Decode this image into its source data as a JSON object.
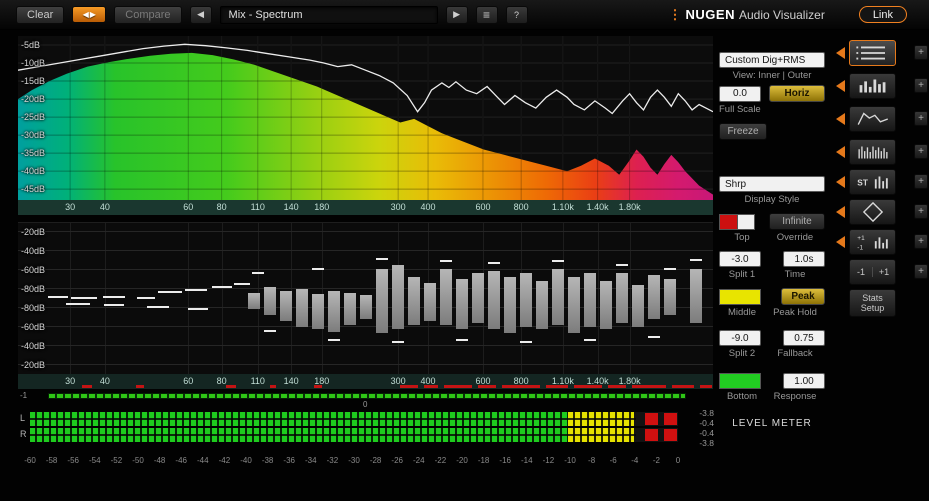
{
  "toolbar": {
    "clear": "Clear",
    "compare": "Compare",
    "preset": "Mix - Spectrum",
    "help": "?",
    "link": "Link",
    "brand_name": "NUGEN",
    "brand_product": "Audio Visualizer"
  },
  "freq_axis": [
    {
      "label": "30",
      "f": 0.075
    },
    {
      "label": "40",
      "f": 0.125
    },
    {
      "label": "60",
      "f": 0.245
    },
    {
      "label": "80",
      "f": 0.293
    },
    {
      "label": "110",
      "f": 0.345
    },
    {
      "label": "140",
      "f": 0.393
    },
    {
      "label": "180",
      "f": 0.437
    },
    {
      "label": "300",
      "f": 0.547
    },
    {
      "label": "400",
      "f": 0.59
    },
    {
      "label": "600",
      "f": 0.669
    },
    {
      "label": "800",
      "f": 0.724
    },
    {
      "label": "1.10k",
      "f": 0.784
    },
    {
      "label": "1.40k",
      "f": 0.834
    },
    {
      "label": "1.80k",
      "f": 0.88
    }
  ],
  "spectrum": {
    "type": "area+line",
    "y_labels": [
      "-5dB",
      "-10dB",
      "-15dB",
      "-20dB",
      "-25dB",
      "-30dB",
      "-35dB",
      "-40dB",
      "-45dB"
    ],
    "y_gridlines_db": [
      -5,
      -10,
      -15,
      -20,
      -25,
      -30,
      -35,
      -40,
      -45
    ],
    "ylim": [
      -48,
      -2.5
    ],
    "gradient": [
      [
        0,
        "#009f9f"
      ],
      [
        0.07,
        "#00b07a"
      ],
      [
        0.14,
        "#28c32a"
      ],
      [
        0.3,
        "#44cb1c"
      ],
      [
        0.44,
        "#9ed011"
      ],
      [
        0.52,
        "#ccd40c"
      ],
      [
        0.6,
        "#e9bc07"
      ],
      [
        0.68,
        "#ec9405"
      ],
      [
        0.76,
        "#ee6a05"
      ],
      [
        0.83,
        "#ea3f14"
      ],
      [
        0.89,
        "#dd2050"
      ],
      [
        0.95,
        "#d41a6e"
      ],
      [
        1,
        "#c81878"
      ]
    ],
    "area_points": [
      [
        0,
        -20
      ],
      [
        0.02,
        -17.5
      ],
      [
        0.045,
        -15
      ],
      [
        0.07,
        -13
      ],
      [
        0.1,
        -11
      ],
      [
        0.13,
        -9.8
      ],
      [
        0.16,
        -8.8
      ],
      [
        0.19,
        -8
      ],
      [
        0.22,
        -7.4
      ],
      [
        0.25,
        -7.2
      ],
      [
        0.28,
        -7.8
      ],
      [
        0.31,
        -9
      ],
      [
        0.34,
        -10.5
      ],
      [
        0.37,
        -12.5
      ],
      [
        0.4,
        -14.5
      ],
      [
        0.43,
        -16.5
      ],
      [
        0.46,
        -19
      ],
      [
        0.49,
        -21.5
      ],
      [
        0.52,
        -24
      ],
      [
        0.55,
        -26.5
      ],
      [
        0.57,
        -25.5
      ],
      [
        0.59,
        -27.5
      ],
      [
        0.61,
        -29.5
      ],
      [
        0.63,
        -31
      ],
      [
        0.65,
        -32.5
      ],
      [
        0.67,
        -34
      ],
      [
        0.7,
        -35.5
      ],
      [
        0.73,
        -37
      ],
      [
        0.76,
        -38.5
      ],
      [
        0.79,
        -40
      ],
      [
        0.81,
        -38.5
      ],
      [
        0.83,
        -36.5
      ],
      [
        0.85,
        -38.5
      ],
      [
        0.865,
        -41
      ],
      [
        0.88,
        -37
      ],
      [
        0.89,
        -34
      ],
      [
        0.9,
        -36
      ],
      [
        0.91,
        -39
      ],
      [
        0.92,
        -41
      ],
      [
        0.93,
        -38
      ],
      [
        0.94,
        -35.5
      ],
      [
        0.95,
        -37.5
      ],
      [
        0.96,
        -40
      ],
      [
        0.97,
        -42
      ],
      [
        0.98,
        -44
      ],
      [
        1,
        -46.5
      ]
    ],
    "line_points": [
      [
        0,
        -12
      ],
      [
        0.03,
        -11
      ],
      [
        0.06,
        -10
      ],
      [
        0.09,
        -9
      ],
      [
        0.12,
        -8
      ],
      [
        0.15,
        -7
      ],
      [
        0.18,
        -6
      ],
      [
        0.21,
        -5.3
      ],
      [
        0.24,
        -4.8
      ],
      [
        0.27,
        -5.2
      ],
      [
        0.3,
        -5.8
      ],
      [
        0.33,
        -6.5
      ],
      [
        0.36,
        -7.4
      ],
      [
        0.39,
        -8.3
      ],
      [
        0.42,
        -9.2
      ],
      [
        0.44,
        -10
      ],
      [
        0.46,
        -11
      ],
      [
        0.48,
        -10.5
      ],
      [
        0.5,
        -12
      ],
      [
        0.52,
        -13.5
      ],
      [
        0.54,
        -15.5
      ],
      [
        0.56,
        -19
      ],
      [
        0.575,
        -23.5
      ],
      [
        0.585,
        -21
      ],
      [
        0.595,
        -17.5
      ],
      [
        0.61,
        -15.5
      ],
      [
        0.62,
        -16.8
      ],
      [
        0.63,
        -15.2
      ],
      [
        0.645,
        -17.5
      ],
      [
        0.66,
        -18.5
      ],
      [
        0.675,
        -16.5
      ],
      [
        0.69,
        -19.5
      ],
      [
        0.7,
        -21.5
      ],
      [
        0.715,
        -19
      ],
      [
        0.73,
        -21
      ],
      [
        0.745,
        -22.5
      ],
      [
        0.76,
        -19.5
      ],
      [
        0.775,
        -17.5
      ],
      [
        0.79,
        -19.5
      ],
      [
        0.8,
        -21.5
      ],
      [
        0.815,
        -23
      ],
      [
        0.83,
        -20.5
      ],
      [
        0.845,
        -22.5
      ],
      [
        0.855,
        -24
      ],
      [
        0.87,
        -20.5
      ],
      [
        0.88,
        -18.5
      ],
      [
        0.89,
        -21
      ],
      [
        0.9,
        -23
      ],
      [
        0.91,
        -19.5
      ],
      [
        0.92,
        -17.5
      ],
      [
        0.93,
        -19.5
      ],
      [
        0.94,
        -22
      ],
      [
        0.95,
        -18.5
      ],
      [
        0.96,
        -20.5
      ],
      [
        0.97,
        -23
      ],
      [
        0.98,
        -21.5
      ],
      [
        1,
        -23.5
      ]
    ]
  },
  "histogram": {
    "type": "bar",
    "y_labels": [
      "-20dB",
      "-40dB",
      "-60dB",
      "-80dB",
      "-80dB",
      "-60dB",
      "-40dB",
      "-20dB"
    ],
    "bars": [
      [
        236,
        6,
        10
      ],
      [
        252,
        12,
        16
      ],
      [
        268,
        8,
        22
      ],
      [
        284,
        10,
        28
      ],
      [
        300,
        5,
        30
      ],
      [
        316,
        8,
        33
      ],
      [
        332,
        6,
        26
      ],
      [
        348,
        4,
        20
      ],
      [
        364,
        30,
        34
      ],
      [
        380,
        34,
        30
      ],
      [
        396,
        22,
        26
      ],
      [
        412,
        16,
        22
      ],
      [
        428,
        30,
        26
      ],
      [
        444,
        20,
        30
      ],
      [
        460,
        26,
        24
      ],
      [
        476,
        28,
        30
      ],
      [
        492,
        22,
        34
      ],
      [
        508,
        26,
        28
      ],
      [
        524,
        18,
        30
      ],
      [
        540,
        30,
        26
      ],
      [
        556,
        22,
        34
      ],
      [
        572,
        26,
        28
      ],
      [
        588,
        18,
        30
      ],
      [
        604,
        26,
        24
      ],
      [
        620,
        14,
        28
      ],
      [
        636,
        24,
        20
      ],
      [
        652,
        20,
        16
      ],
      [
        678,
        30,
        24
      ]
    ],
    "dashes": [
      [
        40,
        -3,
        20
      ],
      [
        66,
        -2,
        26
      ],
      [
        96,
        -3,
        22
      ],
      [
        128,
        -2,
        18
      ],
      [
        152,
        -8,
        24
      ],
      [
        178,
        -10,
        22
      ],
      [
        204,
        -13,
        20
      ],
      [
        224,
        -16,
        16
      ],
      [
        60,
        4,
        24
      ],
      [
        96,
        5,
        20
      ],
      [
        140,
        7,
        22
      ],
      [
        180,
        9,
        20
      ],
      [
        240,
        -27,
        12
      ],
      [
        300,
        -31,
        12
      ],
      [
        364,
        -41,
        12
      ],
      [
        428,
        -39,
        12
      ],
      [
        476,
        -37,
        12
      ],
      [
        540,
        -39,
        12
      ],
      [
        604,
        -35,
        12
      ],
      [
        652,
        -31,
        12
      ],
      [
        678,
        -40,
        12
      ],
      [
        252,
        31,
        12
      ],
      [
        316,
        40,
        12
      ],
      [
        380,
        42,
        12
      ],
      [
        444,
        40,
        12
      ],
      [
        508,
        42,
        12
      ],
      [
        572,
        40,
        12
      ],
      [
        636,
        37,
        12
      ]
    ],
    "red_ticks": [
      [
        64,
        10
      ],
      [
        118,
        8
      ],
      [
        208,
        10
      ],
      [
        252,
        6
      ],
      [
        296,
        8
      ],
      [
        382,
        18
      ],
      [
        406,
        14
      ],
      [
        426,
        28
      ],
      [
        460,
        18
      ],
      [
        484,
        38
      ],
      [
        528,
        22
      ],
      [
        556,
        28
      ],
      [
        590,
        18
      ],
      [
        614,
        34
      ],
      [
        654,
        22
      ],
      [
        682,
        12
      ]
    ]
  },
  "corr": {
    "left_label": "-1",
    "center_label": "0"
  },
  "meter": {
    "type": "level-meter",
    "channels": [
      {
        "label": "L",
        "peaks": [
          0.949,
          0.979
        ]
      },
      {
        "label": "R",
        "peaks": [
          0.949,
          0.979
        ]
      }
    ],
    "green_frac": 0.83,
    "yellow_frac": 0.932,
    "scale": [
      "-60",
      "-58",
      "-56",
      "-54",
      "-52",
      "-50",
      "-48",
      "-46",
      "-44",
      "-42",
      "-40",
      "-38",
      "-36",
      "-34",
      "-32",
      "-30",
      "-28",
      "-26",
      "-24",
      "-22",
      "-20",
      "-18",
      "-16",
      "-14",
      "-12",
      "-10",
      "-8",
      "-6",
      "-4",
      "-2",
      "0"
    ],
    "values": [
      "-3.8",
      "-0.4",
      "-0.4",
      "-3.8"
    ]
  },
  "controls": {
    "mode": "Custom Dig+RMS",
    "view": "View: Inner | Outer",
    "full_scale_value": "0.0",
    "horiz": "Horiz",
    "full_scale_label": "Full Scale",
    "freeze": "Freeze",
    "display_style_value": "Shrp",
    "display_style_label": "Display Style",
    "infinite": "Infinite",
    "top_label": "Top",
    "override_label": "Override",
    "split1_value": "-3.0",
    "time_value": "1.0s",
    "split1_label": "Split 1",
    "time_label": "Time",
    "peak": "Peak",
    "middle_label": "Middle",
    "peak_hold_label": "Peak Hold",
    "split2_value": "-9.0",
    "fallback_value": "0.75",
    "split2_label": "Split 2",
    "fallback_label": "Fallback",
    "response_value": "1.00",
    "bottom_label": "Bottom",
    "response_label": "Response",
    "level_meter_label": "LEVEL METER",
    "colors": {
      "top_swatch": [
        "#cc1010",
        "#f0f0f0"
      ],
      "middle_swatch": "#e8e400",
      "bottom_swatch": "#22cc22"
    }
  },
  "sidebar": {
    "add_label": "+",
    "items": [
      {
        "name": "display-slot-1",
        "icon": "menu-lines-icon",
        "selected": true,
        "tab": true,
        "plus": true
      },
      {
        "name": "display-slot-2",
        "icon": "bars-icon",
        "tab": true,
        "plus": true
      },
      {
        "name": "display-slot-3",
        "icon": "spectrum-curve-icon",
        "tab": true,
        "plus": true
      },
      {
        "name": "display-slot-4",
        "icon": "comb-bars-icon",
        "tab": true,
        "plus": true
      },
      {
        "name": "display-slot-5",
        "icon": "st-bars-icon",
        "icon_labels": [
          "ST"
        ],
        "tab": true,
        "plus": true
      },
      {
        "name": "display-slot-6",
        "icon": "diamond-icon",
        "tab": true,
        "plus": true
      },
      {
        "name": "display-slot-7",
        "icon": "mini-scale-icon",
        "icon_labels": [
          "+1",
          "-1"
        ],
        "tab": true,
        "plus": true
      },
      {
        "name": "range-toggle",
        "labels": [
          "-1",
          "+1"
        ],
        "plus": true
      },
      {
        "name": "stats-setup",
        "label": "Stats Setup",
        "tall": true
      }
    ]
  }
}
